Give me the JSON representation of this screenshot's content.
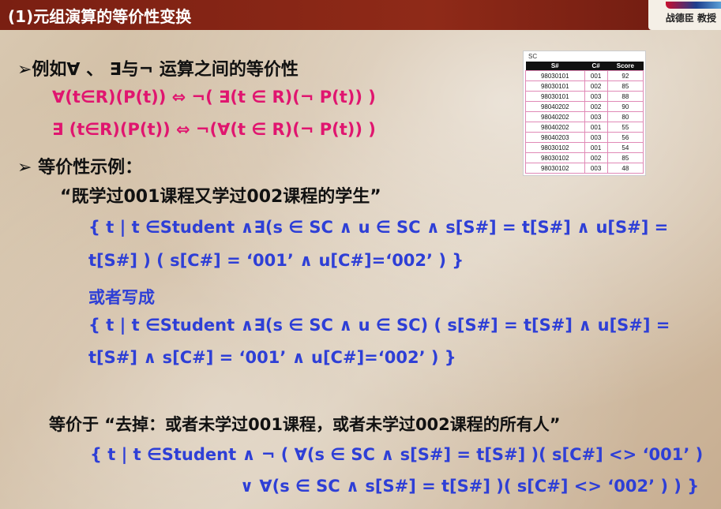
{
  "title": "(1)元组演算的等价性变换",
  "logo": {
    "text": "战德臣 教授"
  },
  "lines": {
    "l1": "➢例如∀ 、 ∃与¬ 运算之间的等价性",
    "l2": "∀(t∈R)(P(t)) ⇔ ¬( ∃(t ∈ R)(¬ P(t)) )",
    "l3": "∃ (t∈R)(P(t)) ⇔ ¬(∀(t ∈ R)(¬ P(t)) )",
    "l4": "➢ 等价性示例：",
    "l5": "“既学过001课程又学过002课程的学生”",
    "l6": "{ t | t ∈Student  ∧∃(s ∈ SC ∧ u ∈ SC ∧ s[S#] = t[S#] ∧ u[S#] =",
    "l7": "t[S#] ) ( s[C#] = ‘001’ ∧ u[C#]=‘002’ ) }",
    "l8": "或者写成",
    "l9": "{ t | t ∈Student  ∧∃(s ∈ SC ∧ u ∈ SC) ( s[S#] = t[S#] ∧ u[S#] =",
    "l10": "t[S#] ∧ s[C#] = ‘001’ ∧ u[C#]=‘002’ ) }",
    "l11": "等价于 “去掉：或者未学过001课程，或者未学过002课程的所有人”",
    "l12": "{ t |  t ∈Student ∧ ¬ ( ∀(s ∈ SC ∧ s[S#] = t[S#] )( s[C#] <> ‘001’ )",
    "l13": "∨ ∀(s ∈ SC ∧ s[S#] = t[S#] )( s[C#] <> ‘002’ ) ) }"
  },
  "sc_table": {
    "name": "SC",
    "headers": [
      "S#",
      "C#",
      "Score"
    ],
    "rows": [
      [
        "98030101",
        "001",
        "92"
      ],
      [
        "98030101",
        "002",
        "85"
      ],
      [
        "98030101",
        "003",
        "88"
      ],
      [
        "98040202",
        "002",
        "90"
      ],
      [
        "98040202",
        "003",
        "80"
      ],
      [
        "98040202",
        "001",
        "55"
      ],
      [
        "98040203",
        "003",
        "56"
      ],
      [
        "98030102",
        "001",
        "54"
      ],
      [
        "98030102",
        "002",
        "85"
      ],
      [
        "98030102",
        "003",
        "48"
      ]
    ]
  }
}
